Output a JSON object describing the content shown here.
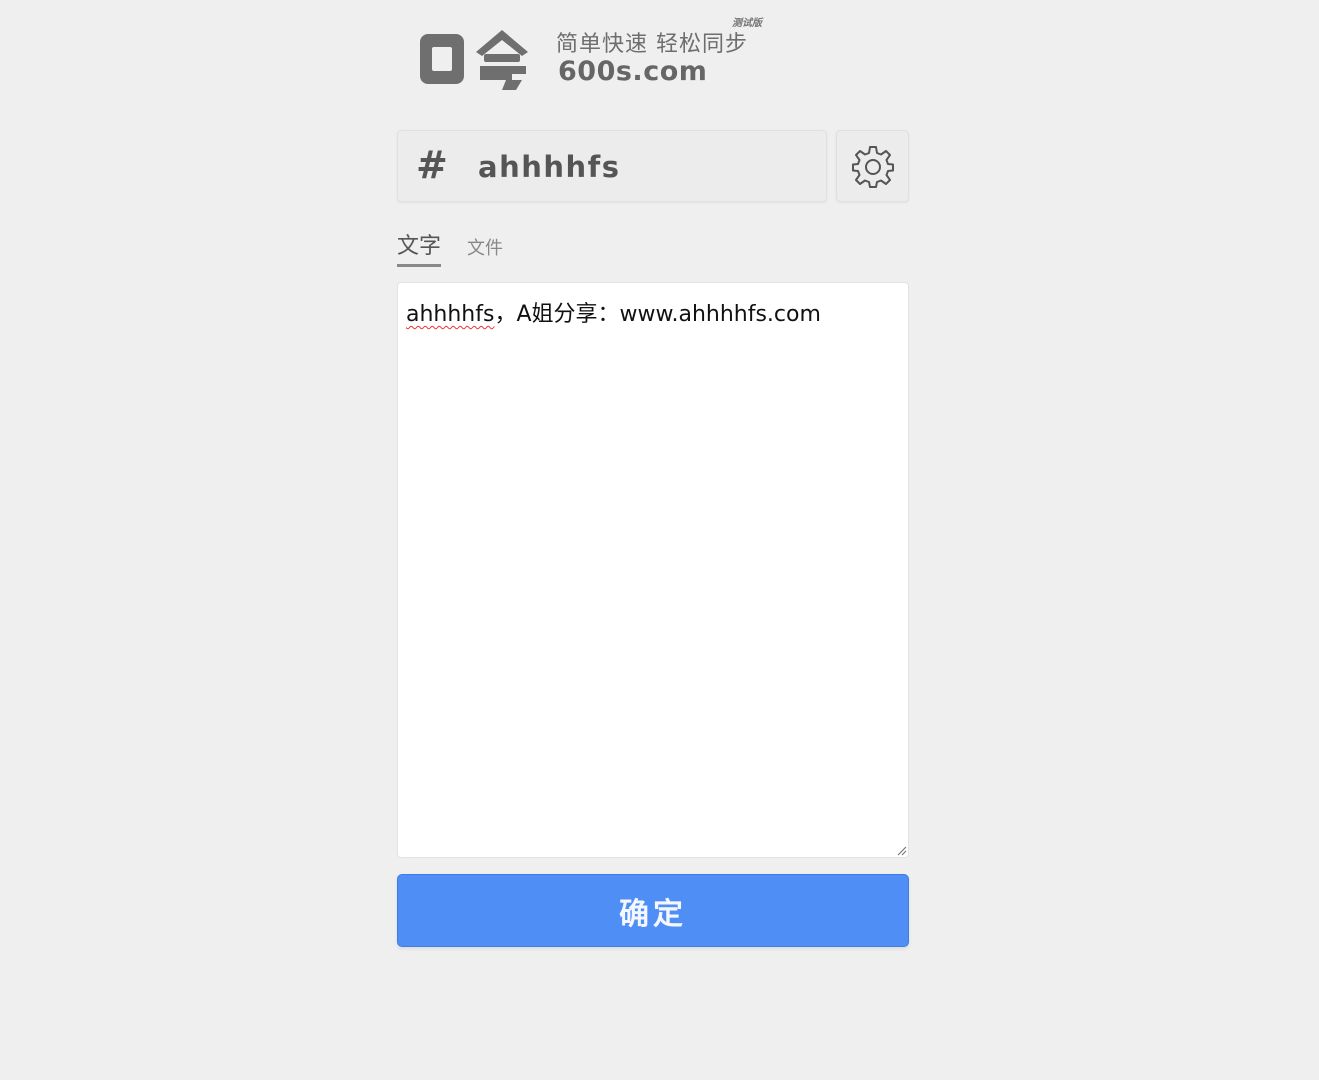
{
  "logo": {
    "tagline": "简单快速 轻松同步",
    "beta_badge": "测试版",
    "domain": "600s.com",
    "mark_icon": "logo-mark-icon"
  },
  "code_field": {
    "prefix_icon": "hash-icon",
    "prefix_symbol": "#",
    "value": "ahhhhfs"
  },
  "settings": {
    "icon": "gear-icon"
  },
  "tabs": [
    {
      "label": "文字",
      "active": true
    },
    {
      "label": "文件",
      "active": false
    }
  ],
  "content": {
    "value_misspelled": "ahhhhfs",
    "value_rest": "，A姐分享：www.ahhhhfs.com"
  },
  "submit": {
    "label": "确定"
  },
  "colors": {
    "background": "#efefef",
    "accent": "#4f8ef5",
    "text_gray": "#555555"
  }
}
